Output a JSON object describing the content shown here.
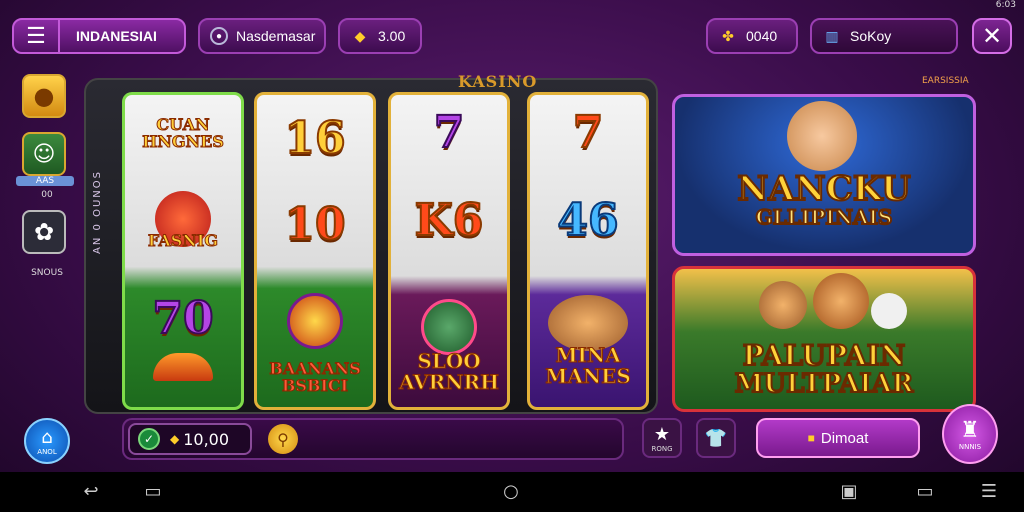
{
  "status": {
    "time": "6:03"
  },
  "topbar": {
    "region_label": "INDANESIAI",
    "username": "Nasdemasar",
    "coins": "3.00",
    "gems": "0040",
    "search_text": "SoKoy"
  },
  "machine": {
    "brand": "KASINO",
    "side_text": "AN 0 OUNOS"
  },
  "reels": [
    {
      "top": "CUAN HNGNES",
      "mid": "FASNIG",
      "bottom": "70"
    },
    {
      "top": "16",
      "mid": "10",
      "bottom": "BAANANS BSBICI"
    },
    {
      "top": "7",
      "mid": "K6",
      "bottom": "SLOO AVRNRH"
    },
    {
      "top": "7",
      "mid": "46",
      "bottom": "MINA MANES"
    }
  ],
  "sidebar": {
    "avatar_tag": "AAS",
    "avatar_value": "00",
    "settings_label": "SNOUS"
  },
  "promos": {
    "tag": "EARSISSIA",
    "card1_line1": "NANCKU",
    "card1_line2": "GLLIPINAIS",
    "card2_line1": "PALUPAIN",
    "card2_line2": "MULTPAIAR"
  },
  "bottombar": {
    "home_label": "ANOL",
    "bet_value": "10,00",
    "fav_label": "RONG",
    "deposit_label": "Dimoat",
    "profile_label": "NNNIS"
  },
  "colors": {
    "accent": "#c35ad9",
    "gold": "#ffcd2a",
    "background": "#3a0d4a"
  }
}
